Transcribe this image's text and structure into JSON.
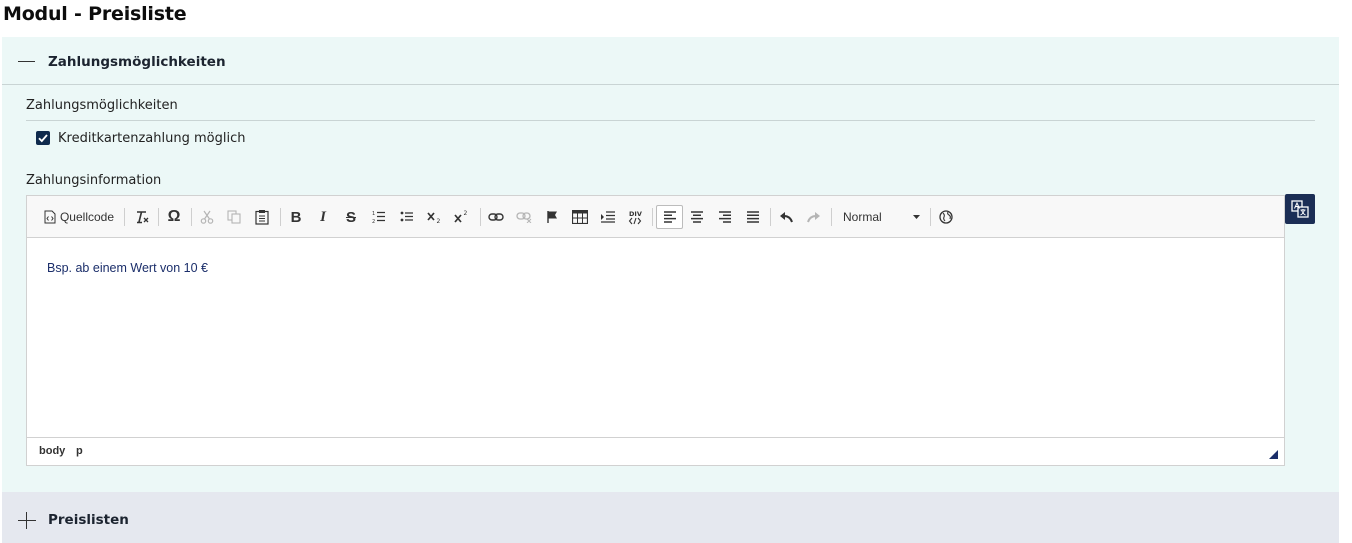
{
  "page": {
    "title": "Modul - Preisliste"
  },
  "section1": {
    "header": "Zahlungsmöglichkeiten",
    "group_label": "Zahlungsmöglichkeiten",
    "checkbox": {
      "label": "Kreditkartenzahlung möglich",
      "checked": true
    },
    "field_label": "Zahlungsinformation",
    "editor": {
      "toolbar": {
        "source_label": "Quellcode",
        "format_value": "Normal"
      },
      "content": "Bsp. ab einem Wert von 10 €",
      "statusbar": [
        "body",
        "p"
      ]
    }
  },
  "section2": {
    "header": "Preislisten"
  },
  "colors": {
    "accent": "#1b2e55",
    "checkbox": "#0f2a4d",
    "section_bg": "#ecf8f7",
    "collapsed_bg": "#e5e8ef",
    "text_content": "#1b2e6a"
  }
}
